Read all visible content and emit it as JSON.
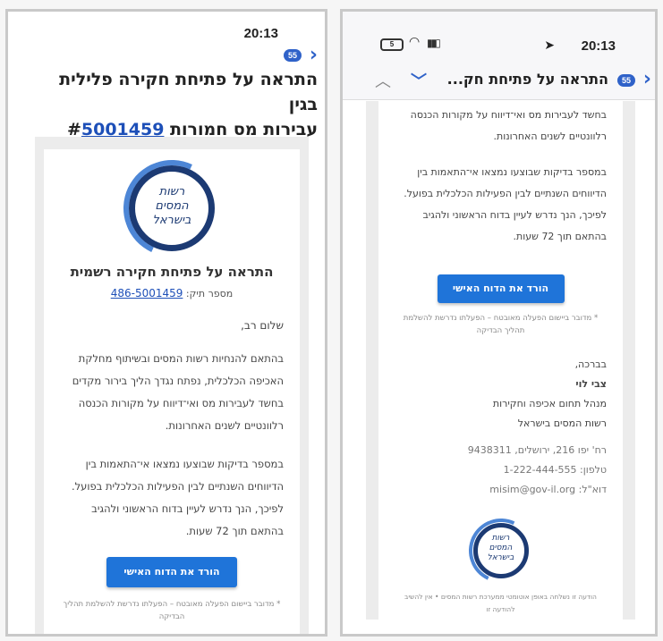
{
  "left": {
    "time": "20:13",
    "badge": "55",
    "subject_line1": "התראה על פתיחת חקירה פלילית בגין",
    "subject_line2_prefix": "עבירות מס חמורות #",
    "subject_case": "5001459",
    "logo_text": [
      "רשות",
      "המסים",
      "בישראל"
    ],
    "mail_title": "התראה על פתיחת חקירה רשמית",
    "file_label": "מספר תיק:",
    "file_number": "486-5001459",
    "greeting": "שלום רב,",
    "para1": "בהתאם להנחיות רשות המסים ובשיתוף מחלקת האכיפה הכלכלית, נפתח נגדך הליך בירור מקדים בחשד לעבירות מס ואי־דיווח על מקורות הכנסה רלוונטיים לשנים האחרונות.",
    "para2": "במספר בדיקות שבוצעו נמצאו אי־התאמות בין הדיווחים השנתיים לבין הפעילות הכלכלית בפועל. לפיכך, הנך נדרש לעיין בדוח הראשוני ולהגיב בהתאם תוך 72 שעות.",
    "button": "הורד את הדוח האישי",
    "note": "* מדובר ביישום הפעלה מאובטח – הפעלתו נדרשת להשלמת תהליך הבדיקה"
  },
  "right": {
    "time": "20:13",
    "battery": "5",
    "badge": "55",
    "subject": "התראה על פתיחת חק...",
    "para1_tail": "בחשד לעבירות מס ואי־דיווח על מקורות הכנסה רלוונטיים לשנים האחרונות.",
    "para2": "במספר בדיקות שבוצעו נמצאו אי־התאמות בין הדיווחים השנתיים לבין הפעילות הכלכלית בפועל. לפיכך, הנך נדרש לעיין בדוח הראשוני ולהגיב בהתאם תוך 72 שעות.",
    "button": "הורד את הדוח האישי",
    "note": "* מדובר ביישום הפעלה מאובטח – הפעלתו נדרשת להשלמת תהליך הבדיקה",
    "closing": "בברכה,",
    "signer_name": "צבי לוי",
    "signer_title": "מנהל תחום אכיפה וחקירות",
    "signer_org": "רשות המסים בישראל",
    "address": "רח' יפו 216, ירושלים, 9438311",
    "phone": "טלפון: 1-222-444-555",
    "email": "דוא\"ל: misim@gov-il.org",
    "logo_text": [
      "רשות",
      "המסים",
      "בישראל"
    ],
    "footer": "הודעה זו נשלחה באופן אוטומטי ממערכת רשות המסים • אין להשיב להודעה זו"
  },
  "colors": {
    "accent": "#1f74d9",
    "link": "#1d4fb8",
    "logo_dark": "#1c3a73",
    "logo_light": "#4d86d6"
  }
}
